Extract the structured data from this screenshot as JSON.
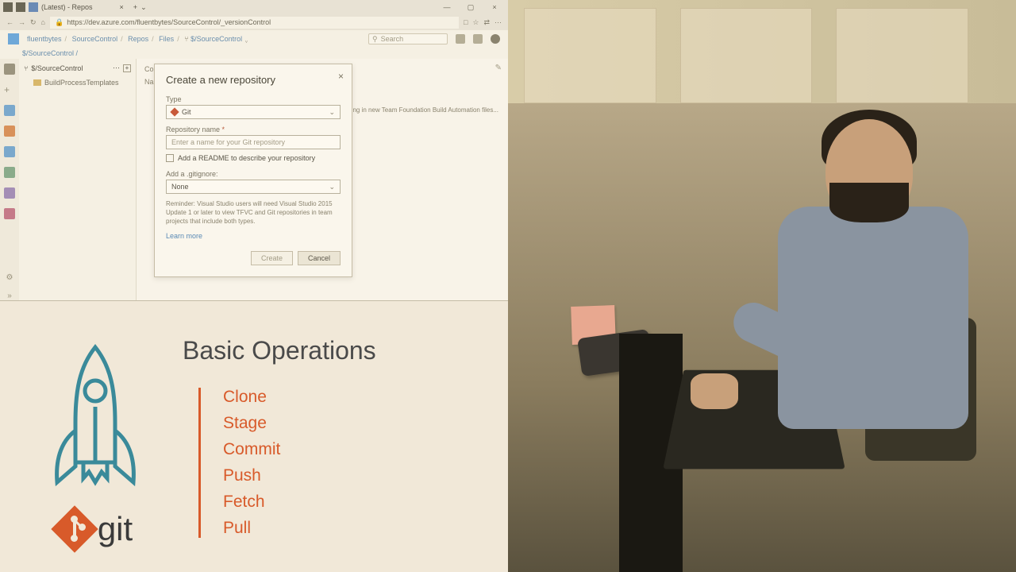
{
  "browser": {
    "tab_title": "(Latest) - Repos",
    "url": "https://dev.azure.com/fluentbytes/SourceControl/_versionControl"
  },
  "devops": {
    "breadcrumb": {
      "org": "fluentbytes",
      "project": "SourceControl",
      "section": "Repos",
      "sub": "Files",
      "repo": "$/SourceControl"
    },
    "search_placeholder": "Search",
    "path_breadcrumb": "$/SourceControl /",
    "tree": {
      "root": "$/SourceControl",
      "items": [
        "BuildProcessTemplates"
      ]
    },
    "content": {
      "tab": "Con",
      "col": "Nam",
      "desc": "Checking in new Team Foundation Build Automation files..."
    }
  },
  "modal": {
    "title": "Create a new repository",
    "type_label": "Type",
    "type_value": "Git",
    "name_label": "Repository name",
    "name_placeholder": "Enter a name for your Git repository",
    "readme_label": "Add a README to describe your repository",
    "gitignore_label": "Add a .gitignore:",
    "gitignore_value": "None",
    "reminder": "Reminder: Visual Studio users will need Visual Studio 2015 Update 1 or later to view TFVC and Git repositories in team projects that include both types.",
    "learn_more": "Learn more",
    "create": "Create",
    "cancel": "Cancel"
  },
  "slide": {
    "title": "Basic Operations",
    "git_label": "git",
    "ops": [
      "Clone",
      "Stage",
      "Commit",
      "Push",
      "Fetch",
      "Pull"
    ]
  }
}
